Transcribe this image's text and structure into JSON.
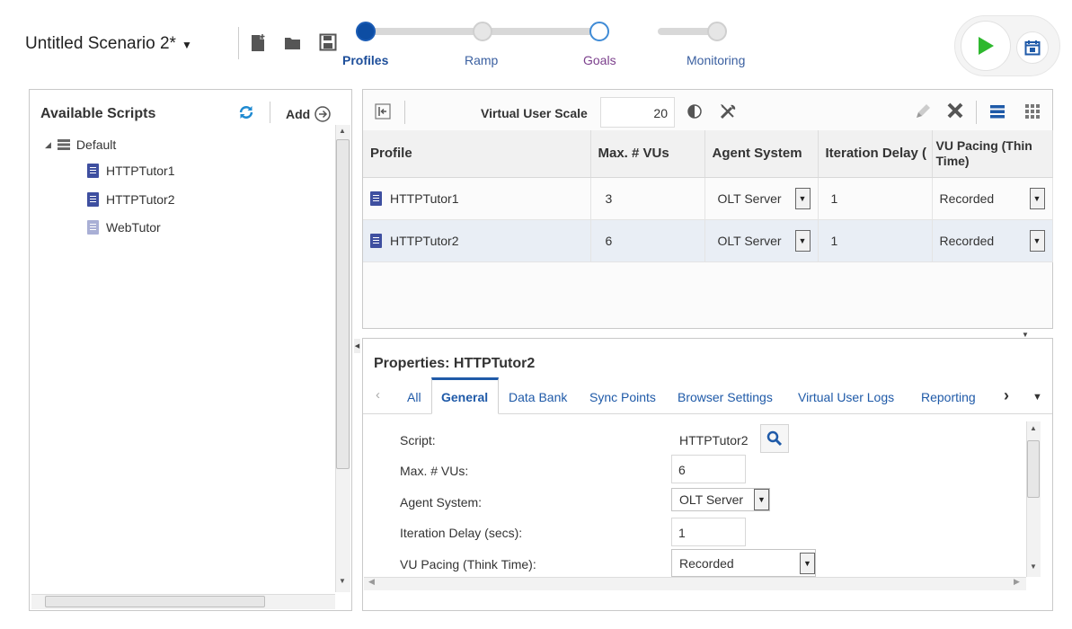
{
  "header": {
    "scenario_title": "Untitled Scenario 2*",
    "steps": [
      {
        "label": "Profiles",
        "state": "current"
      },
      {
        "label": "Ramp",
        "state": "upcoming"
      },
      {
        "label": "Goals",
        "state": "visited"
      },
      {
        "label": "Monitoring",
        "state": "upcoming"
      }
    ]
  },
  "left_panel": {
    "title": "Available Scripts",
    "add_label": "Add",
    "tree": {
      "root": "Default",
      "items": [
        "HTTPTutor1",
        "HTTPTutor2",
        "WebTutor"
      ]
    }
  },
  "profiles_toolbar": {
    "scale_label": "Virtual User Scale",
    "scale_value": "20"
  },
  "profiles_table": {
    "columns": [
      "Profile",
      "Max. # VUs",
      "Agent System",
      "Iteration Delay (",
      "VU Pacing (Thin Time)"
    ],
    "rows": [
      {
        "profile": "HTTPTutor1",
        "max_vus": "3",
        "agent": "OLT Server",
        "delay": "1",
        "pacing": "Recorded"
      },
      {
        "profile": "HTTPTutor2",
        "max_vus": "6",
        "agent": "OLT Server",
        "delay": "1",
        "pacing": "Recorded"
      }
    ]
  },
  "properties": {
    "title": "Properties: HTTPTutor2",
    "tabs": [
      "All",
      "General",
      "Data Bank",
      "Sync Points",
      "Browser Settings",
      "Virtual User Logs",
      "Reporting"
    ],
    "active_tab": "General",
    "fields": {
      "script_label": "Script:",
      "script_value": "HTTPTutor2",
      "max_vus_label": "Max. # VUs:",
      "max_vus_value": "6",
      "agent_label": "Agent System:",
      "agent_value": "OLT Server",
      "delay_label": "Iteration Delay (secs):",
      "delay_value": "1",
      "pacing_label": "VU Pacing (Think Time):",
      "pacing_value": "Recorded"
    }
  },
  "colors": {
    "accent": "#1f5aa8",
    "run_green": "#2eb82e",
    "visited": "#7b3f8c"
  }
}
